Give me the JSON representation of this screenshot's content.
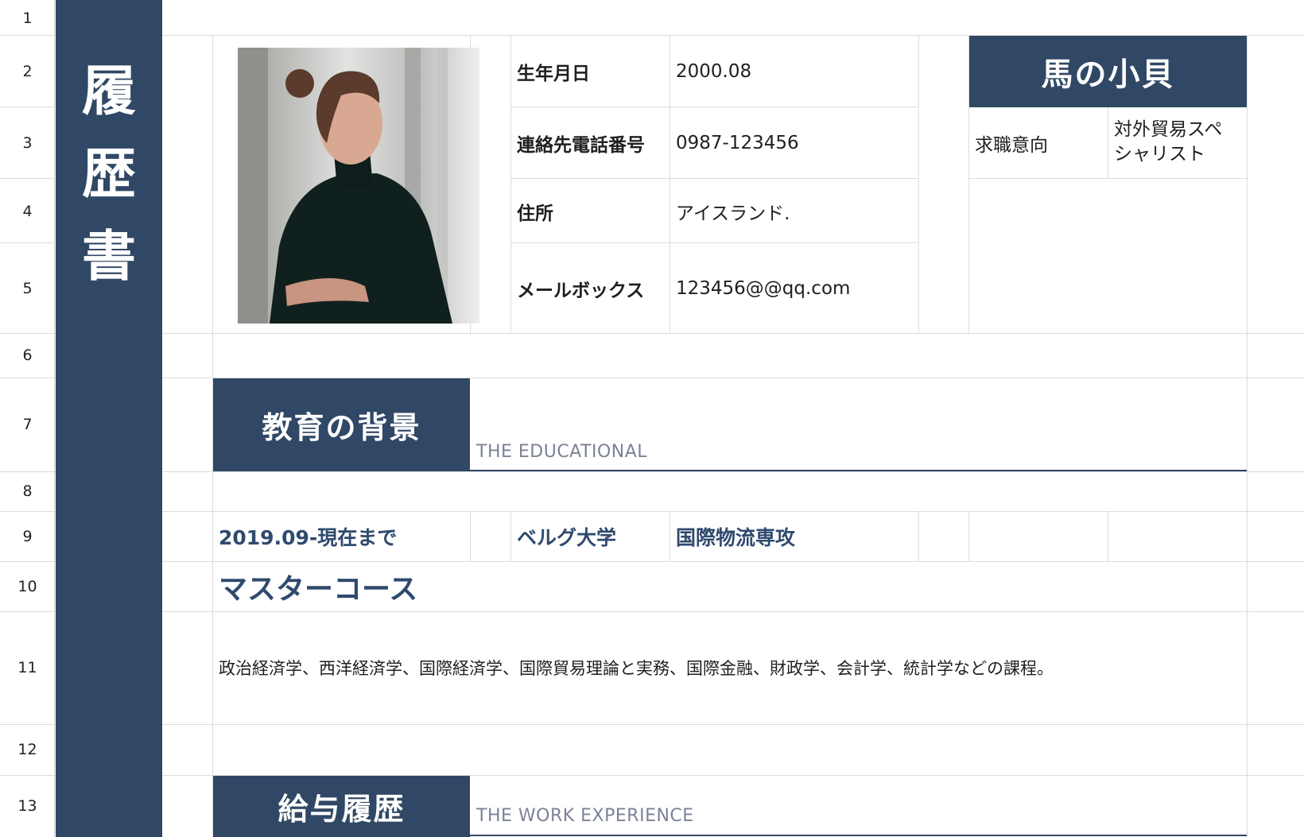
{
  "rows": [
    "1",
    "2",
    "3",
    "4",
    "5",
    "6",
    "7",
    "8",
    "9",
    "10",
    "11",
    "12",
    "13"
  ],
  "sidebar": {
    "title_chars": [
      "履",
      "歴",
      "書"
    ]
  },
  "profile": {
    "photo_alt": "profile-photo",
    "fields": [
      {
        "label": "生年月日",
        "value": "2000.08"
      },
      {
        "label": "連絡先電話番号",
        "value": "0987-123456"
      },
      {
        "label": "住所",
        "value": "アイスランド."
      },
      {
        "label": "メールボックス",
        "value": "123456@@qq.com"
      }
    ],
    "name": "馬の小貝",
    "job_label": "求職意向",
    "job_value_line1": "対外貿易スペ",
    "job_value_line2": "シャリスト"
  },
  "education": {
    "title": "教育の背景",
    "subtitle": "THE EDUCATIONAL",
    "period": "2019.09-現在まで",
    "school": "ベルグ大学",
    "major": "国際物流専攻",
    "degree": "マスターコース",
    "courses": "政治経済学、西洋経済学、国際経済学、国際貿易理論と実務、国際金融、財政学、会計学、統計学などの課程。"
  },
  "work": {
    "title": "給与履歴",
    "subtitle": "THE WORK EXPERIENCE"
  },
  "colors": {
    "accent": "#304865",
    "grid": "#dcdcdc",
    "subtitle": "#7b8296"
  }
}
